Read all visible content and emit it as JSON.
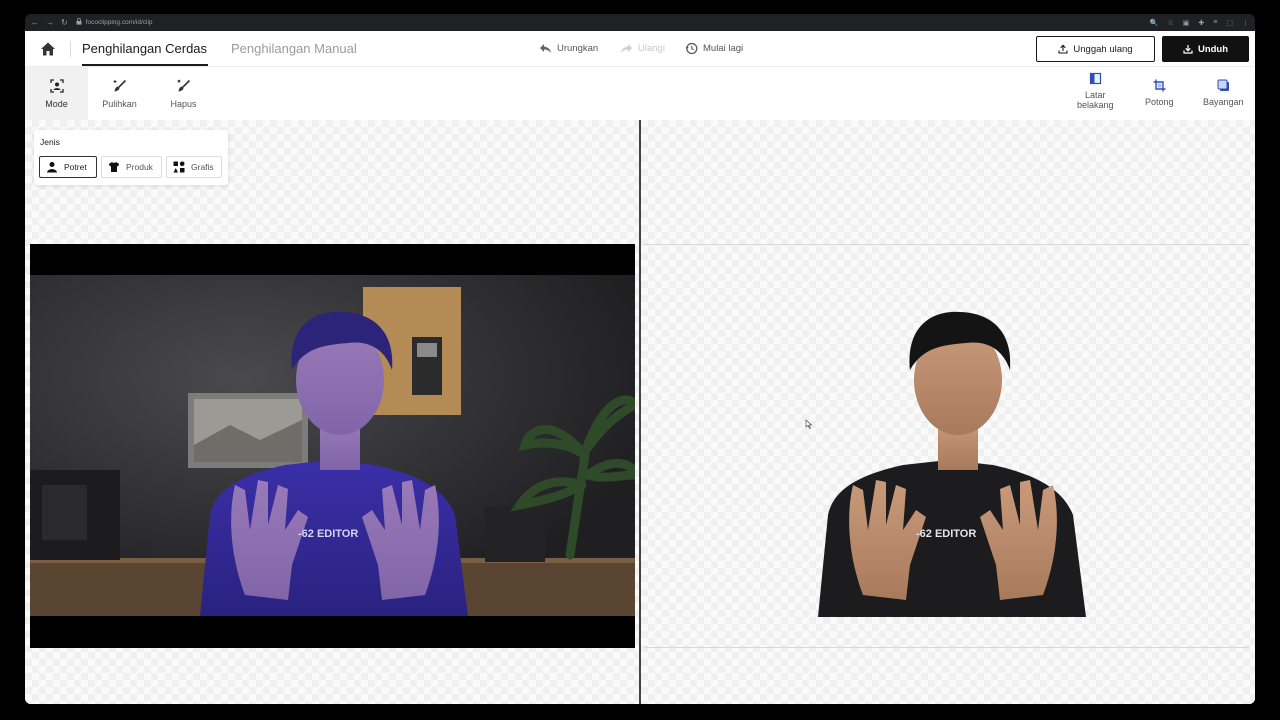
{
  "browser": {
    "url": "fococlipping.com/id/clip",
    "nav": [
      "←",
      "→",
      "↻"
    ],
    "right_icons": [
      "🔍",
      "☆",
      "▣",
      "✚",
      "≡",
      "⬚",
      "⋮"
    ]
  },
  "topbar": {
    "tabs": [
      {
        "label": "Penghilangan Cerdas",
        "active": true
      },
      {
        "label": "Penghilangan Manual",
        "active": false
      }
    ],
    "history": {
      "undo": "Urungkan",
      "redo": "Ulangi",
      "reset": "Mulai lagi"
    },
    "reupload_label": "Unggah ulang",
    "download_label": "Unduh"
  },
  "tools": [
    {
      "label": "Mode",
      "icon": "mode-icon"
    },
    {
      "label": "Pulihkan",
      "icon": "restore-brush-icon"
    },
    {
      "label": "Hapus",
      "icon": "erase-brush-icon"
    }
  ],
  "right_tools": [
    {
      "label_line1": "Latar",
      "label_line2": "belakang",
      "icon": "background-icon"
    },
    {
      "label_line1": "Potong",
      "label_line2": "",
      "icon": "crop-icon"
    },
    {
      "label_line1": "Bayangan",
      "label_line2": "",
      "icon": "shadow-icon"
    }
  ],
  "jenis": {
    "title": "Jenis",
    "types": [
      {
        "label": "Potret",
        "icon": "person-icon",
        "selected": true
      },
      {
        "label": "Produk",
        "icon": "tshirt-icon",
        "selected": false
      },
      {
        "label": "Grafis",
        "icon": "shapes-icon",
        "selected": false
      }
    ]
  },
  "shirt_text": "-62 EDITOR",
  "colors": {
    "accent": "#111111",
    "shirt_original": "#3a2fa0",
    "shirt_result": "#1b1b1e"
  }
}
